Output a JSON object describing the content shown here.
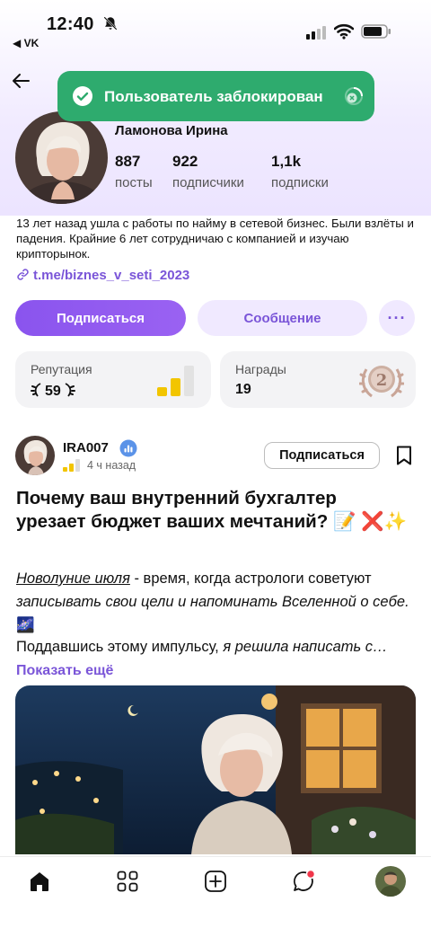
{
  "status_bar": {
    "time": "12:40",
    "back_app": "◀ VK"
  },
  "toast": {
    "text": "Пользователь заблокирован"
  },
  "profile": {
    "name": "Ламонова Ирина",
    "stats": [
      {
        "value": "887",
        "label": "посты"
      },
      {
        "value": "922",
        "label": "подписчики"
      },
      {
        "value": "1,1k",
        "label": "подписки"
      }
    ],
    "bio": "13 лет назад ушла с работы по найму в сетевой бизнес. Были взлёты и падения. Крайние 6 лет сотрудничаю с компанией и изучаю крипторынок.",
    "link": "t.me/biznes_v_seti_2023",
    "subscribe_label": "Подписаться",
    "message_label": "Сообщение",
    "more_label": "···"
  },
  "cards": {
    "reputation": {
      "title": "Репутация",
      "value": "59",
      "level": 0.6
    },
    "awards": {
      "title": "Награды",
      "value": "19",
      "medal_number": "2"
    }
  },
  "post": {
    "author": "IRA007",
    "time": "4 ч назад",
    "follow_label": "Подписаться",
    "title": "Почему ваш внутренний бухгалтер урезает бюджет ваших мечтаний? 📝 ❌✨",
    "p1_link": "Новолуние июля",
    "p1_rest": " - время, когда астрологи советуют ",
    "p1_italic": "записывать свои цели и напоминать Вселенной о себе.",
    "p1_emoji": "🌌",
    "p2_start": "Поддавшись этому импульсу, ",
    "p2_italic": "я решила написать с…",
    "show_more": "Показать ещё"
  },
  "colors": {
    "accent": "#8b5cf6",
    "toast": "#2eab6e",
    "link": "#7a55d8"
  },
  "bottom_nav": [
    "home-icon",
    "apps-icon",
    "add-icon",
    "messages-icon",
    "profile-avatar"
  ]
}
